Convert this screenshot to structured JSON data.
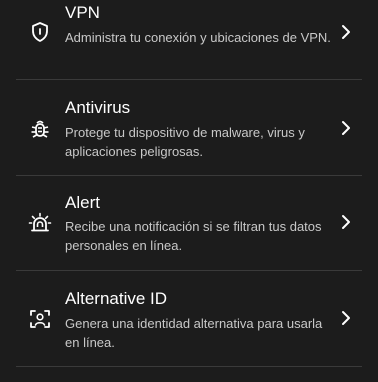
{
  "items": [
    {
      "title": "VPN",
      "description": "Administra tu conexión y ubicaciones de VPN.",
      "icon": "shield-icon"
    },
    {
      "title": "Antivirus",
      "description": "Protege tu dispositivo de malware, virus y aplicaciones peligrosas.",
      "icon": "bug-icon"
    },
    {
      "title": "Alert",
      "description": "Recibe una notificación si se filtran tus datos personales en línea.",
      "icon": "alarm-icon"
    },
    {
      "title": "Alternative ID",
      "description": "Genera una identidad alternativa para usarla en línea.",
      "icon": "face-scan-icon"
    }
  ],
  "colors": {
    "background": "#1c1c1c",
    "title": "#ffffff",
    "description": "#c8c8c8",
    "divider": "#3a3a3a"
  }
}
